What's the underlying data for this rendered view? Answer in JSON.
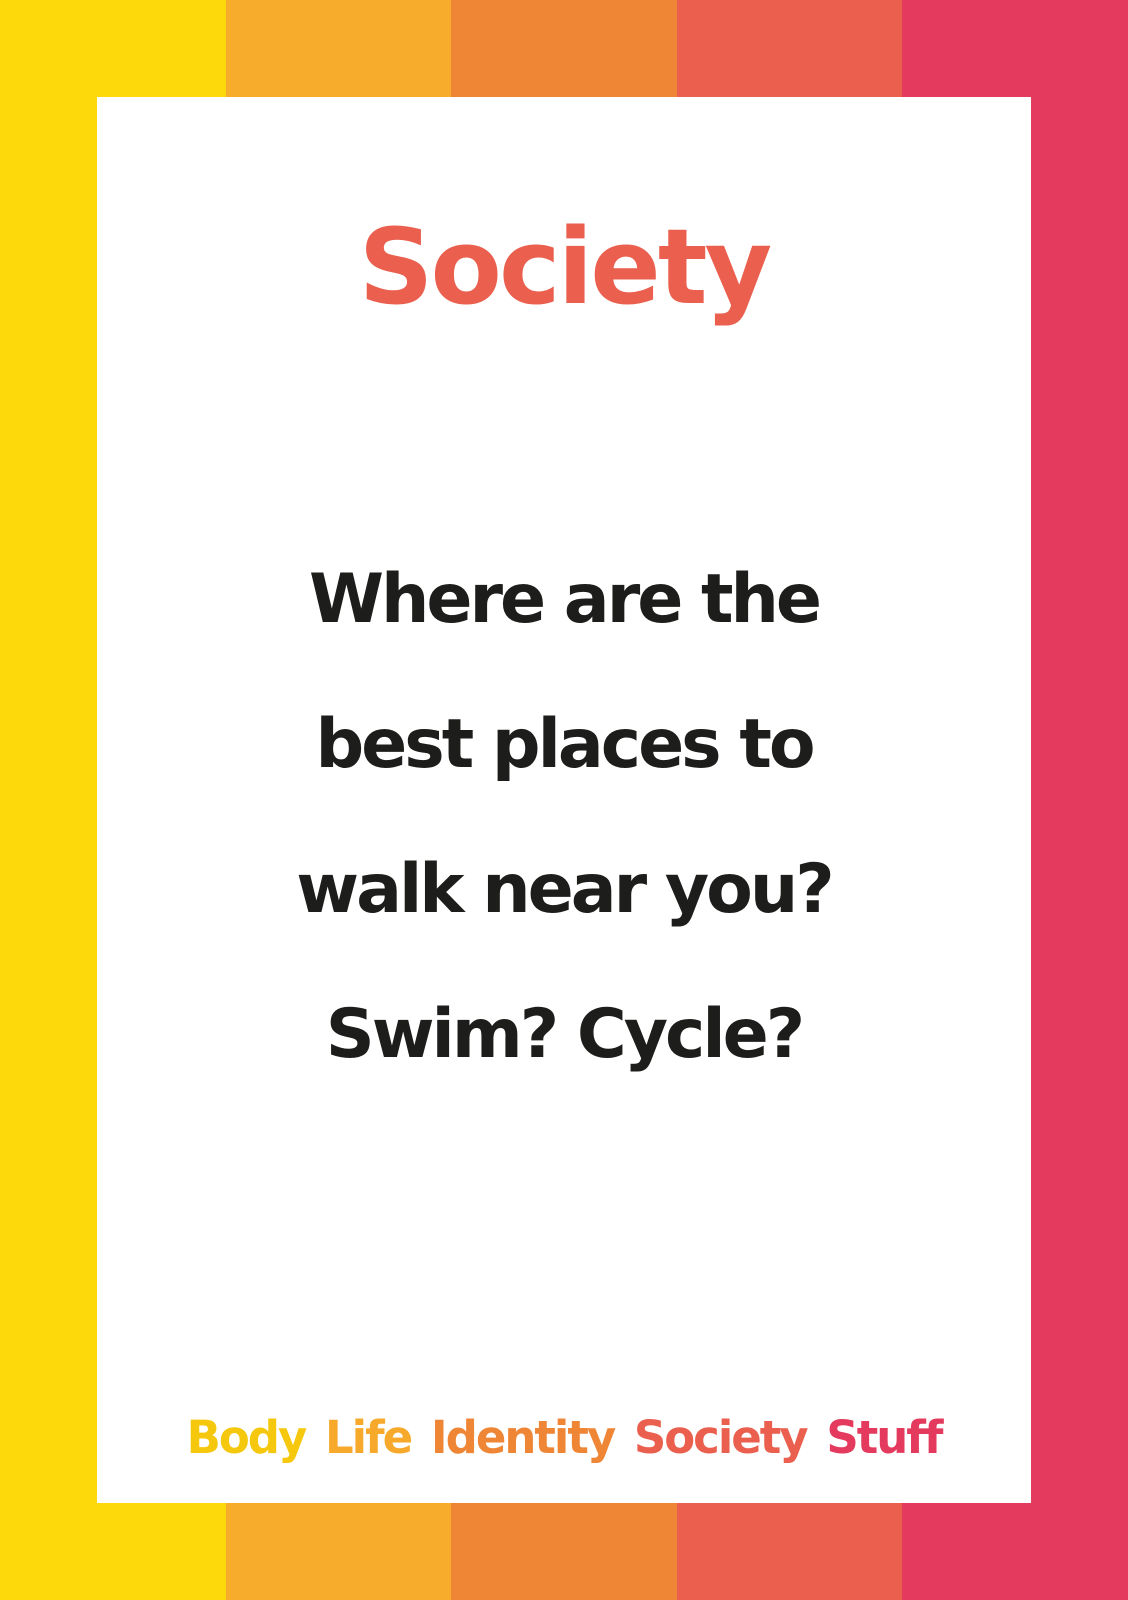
{
  "colors": {
    "stripes": [
      "#fdd80a",
      "#f7ac2c",
      "#ef8636",
      "#ea5f4e",
      "#e33a5d"
    ],
    "title": "#ea5f4e",
    "question_text": "#1d1d1b",
    "card_background": "#ffffff"
  },
  "card": {
    "title": "Society",
    "question_lines": [
      "Where are the",
      "best places to",
      "walk near you?",
      "Swim? Cycle?"
    ]
  },
  "footer": {
    "categories": [
      {
        "label": "Body",
        "color": "#f5c80e"
      },
      {
        "label": "Life",
        "color": "#f6a92b"
      },
      {
        "label": "Identity",
        "color": "#ef8636"
      },
      {
        "label": "Society",
        "color": "#ea5f4e"
      },
      {
        "label": "Stuff",
        "color": "#e33a5d"
      }
    ]
  }
}
